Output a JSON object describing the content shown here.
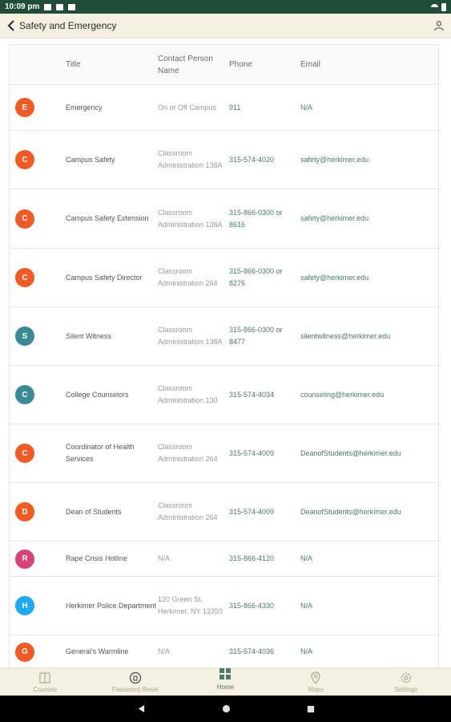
{
  "status_bar": {
    "time": "10:09 pm"
  },
  "header": {
    "title": "Safety and Emergency"
  },
  "table": {
    "columns": {
      "title": "Title",
      "contact": "Contact Person Name",
      "phone": "Phone",
      "email": "Email"
    },
    "rows": [
      {
        "initial": "E",
        "color": "#f25a24",
        "title": "Emergency",
        "contact": "On or Off Campus",
        "phone": "911",
        "email": "N/A"
      },
      {
        "initial": "C",
        "color": "#f25a24",
        "title": "Campus Safety",
        "contact": "Classroom Administration 138A",
        "phone": "315-574-4020",
        "email": "safety@herkimer.edu"
      },
      {
        "initial": "C",
        "color": "#f25a24",
        "title": "Campus Safety Extension",
        "contact": "Classroom Administration 138A",
        "phone": "315-866-0300 or 8616",
        "email": "safety@herkimer.edu"
      },
      {
        "initial": "C",
        "color": "#f25a24",
        "title": "Campus Safety Director",
        "contact": "Classroom Administration 264",
        "phone": "315-866-0300 or 8276",
        "email": "safety@herkimer.edu"
      },
      {
        "initial": "S",
        "color": "#3a8a94",
        "title": "Silent Witness",
        "contact": "Classroom Administration 138A",
        "phone": "315-866-0300 or 8477",
        "email": "silentwitness@herkimer.edu"
      },
      {
        "initial": "C",
        "color": "#3a8a94",
        "title": "College Counselors",
        "contact": "Classroom Administration 130",
        "phone": "315-574-4034",
        "email": "counseling@herkimer.edu"
      },
      {
        "initial": "C",
        "color": "#f25a24",
        "title": "Coordinator of Health Services",
        "contact": "Classroom Administration 264",
        "phone": "315-574-4009",
        "email": "DeanofStudents@herkimer.edu"
      },
      {
        "initial": "D",
        "color": "#f25a24",
        "title": "Dean of Students",
        "contact": "Classroom Administration 264",
        "phone": "315-574-4009",
        "email": "DeanofStudents@herkimer.edu"
      },
      {
        "initial": "R",
        "color": "#d9407a",
        "title": "Rape Crisis Hotline",
        "contact": "N/A",
        "phone": "315-866-4120",
        "email": "N/A"
      },
      {
        "initial": "H",
        "color": "#1eaaf1",
        "title": "Herkimer Police Department",
        "contact": "120 Green St, Herkimer, NY 13350",
        "phone": "315-866-4330",
        "email": "N/A"
      },
      {
        "initial": "G",
        "color": "#f25a24",
        "title": "General's Warmline",
        "contact": "N/A",
        "phone": "315-574-4036",
        "email": "N/A"
      }
    ]
  },
  "bottom_nav": {
    "items": [
      {
        "label": "Courses",
        "icon": "book-icon"
      },
      {
        "label": "Password Reset",
        "icon": "lock-icon"
      },
      {
        "label": "Home",
        "icon": "home-grid-icon"
      },
      {
        "label": "Maps",
        "icon": "map-pin-icon"
      },
      {
        "label": "Settings",
        "icon": "gear-icon"
      }
    ]
  }
}
